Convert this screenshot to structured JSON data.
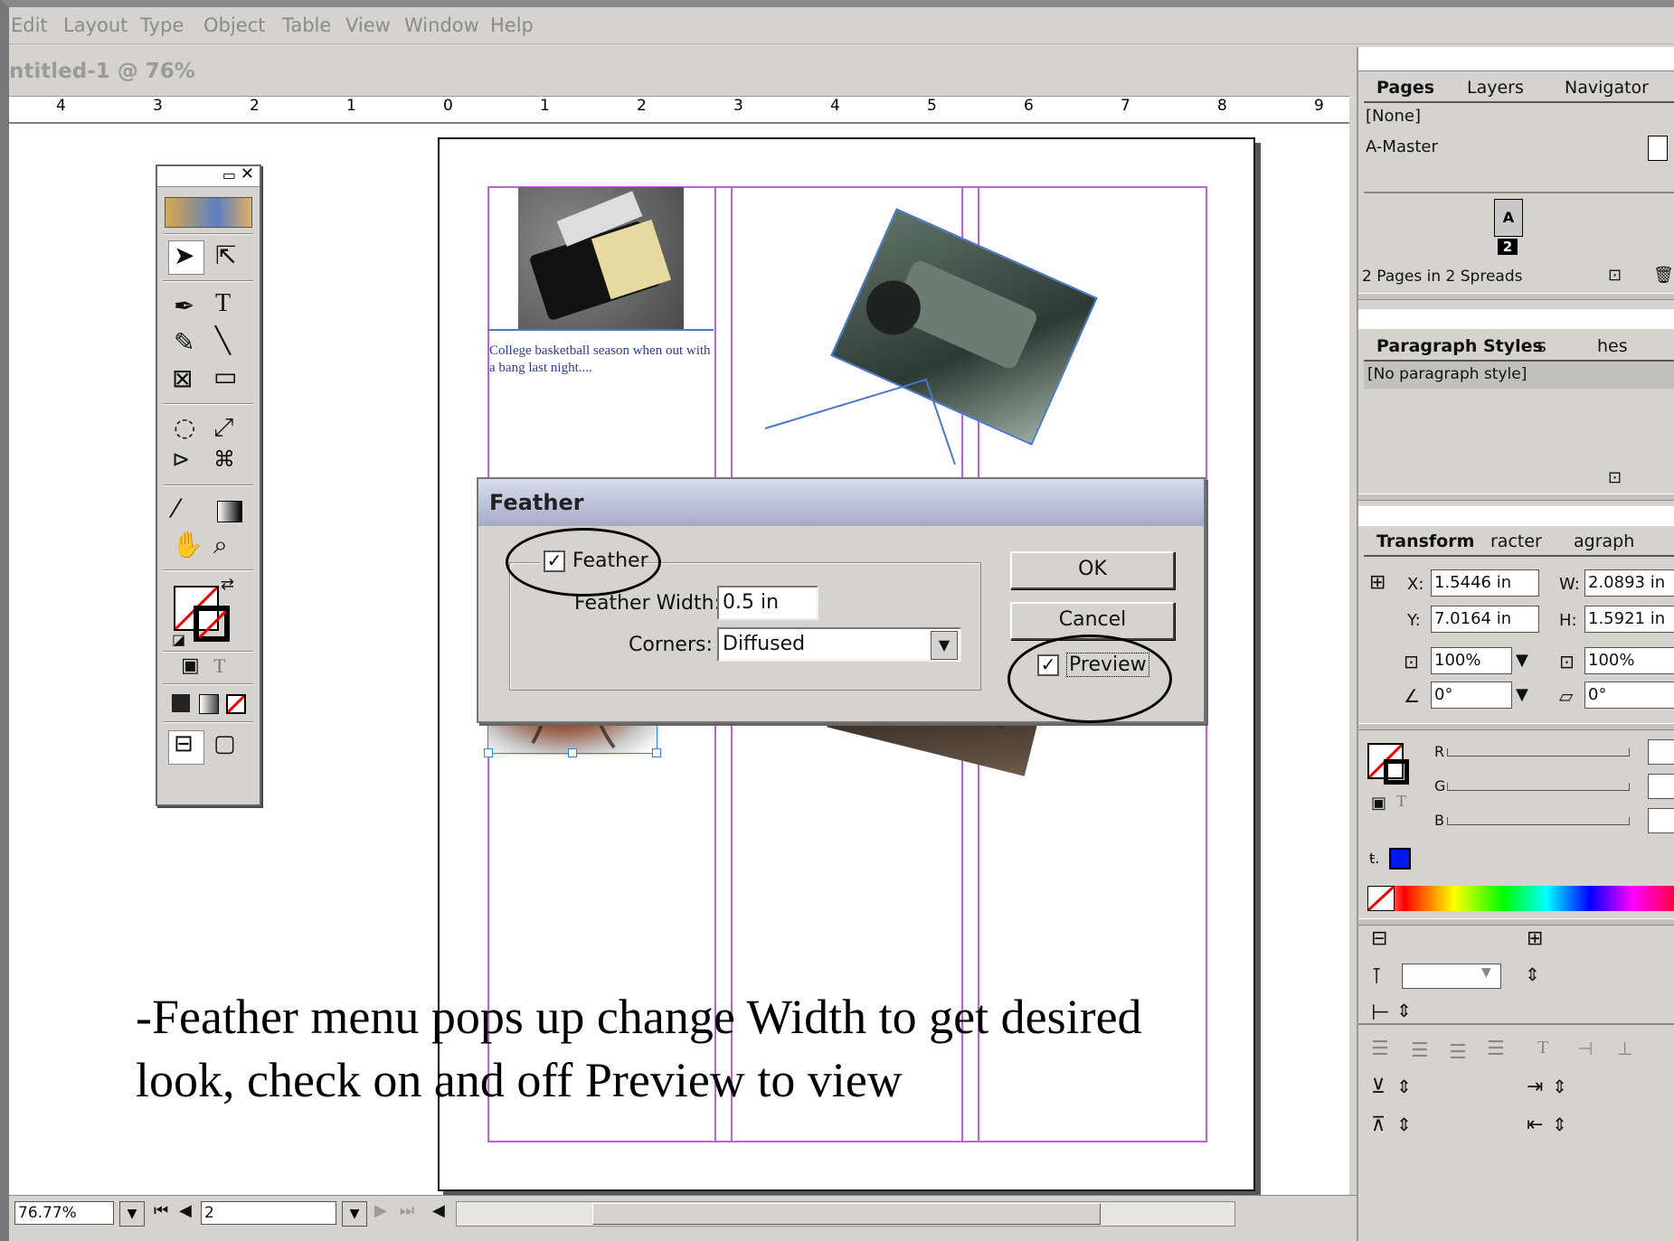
{
  "menubar": {
    "items": [
      "Edit",
      "Layout",
      "Type",
      "Object",
      "Table",
      "View",
      "Window",
      "Help"
    ]
  },
  "document": {
    "title": "ntitled-1 @ 76%",
    "ruler_labels": [
      "4",
      "3",
      "2",
      "1",
      "0",
      "1",
      "2",
      "3",
      "4",
      "5",
      "6",
      "7",
      "8",
      "9"
    ]
  },
  "page": {
    "text_frame": "College basketball season when out with a bang last night...."
  },
  "dialog": {
    "title": "Feather",
    "feather_checkbox_label": "Feather",
    "feather_checked": true,
    "feather_width_label": "Feather Width:",
    "feather_width_value": "0.5 in",
    "corners_label": "Corners:",
    "corners_value": "Diffused",
    "ok_label": "OK",
    "cancel_label": "Cancel",
    "preview_label": "Preview",
    "preview_checked": true
  },
  "pages_panel": {
    "tabs": [
      "Pages",
      "Layers",
      "Navigator"
    ],
    "items": [
      "[None]",
      "A-Master"
    ],
    "page_badge": "2",
    "page_letter": "A",
    "footer": "2 Pages in 2 Spreads"
  },
  "paragraph_panel": {
    "tabs": [
      "Paragraph Styles",
      "s",
      "hes"
    ],
    "items": [
      "[No paragraph style]"
    ]
  },
  "transform_panel": {
    "tabs": [
      "Transform",
      "racter",
      "agraph"
    ],
    "x_label": "X:",
    "x_value": "1.5446 in",
    "y_label": "Y:",
    "y_value": "7.0164 in",
    "w_label": "W:",
    "w_value": "2.0893 in",
    "h_label": "H:",
    "h_value": "1.5921 in",
    "scale_x": "100%",
    "scale_y": "100%",
    "rotate": "0°",
    "shear": "0°"
  },
  "color_panel": {
    "r_label": "R",
    "g_label": "G",
    "b_label": "B"
  },
  "statusbar": {
    "zoom": "76.77%",
    "page": "2"
  },
  "caption": {
    "line1": "-Feather menu pops up change Width to get desired",
    "line2": "look, check on and off Preview to view"
  },
  "colors": {
    "guide": "#c45ce6",
    "dialog_title": "#a7acc6",
    "text_frame": "#2a3b9a"
  }
}
